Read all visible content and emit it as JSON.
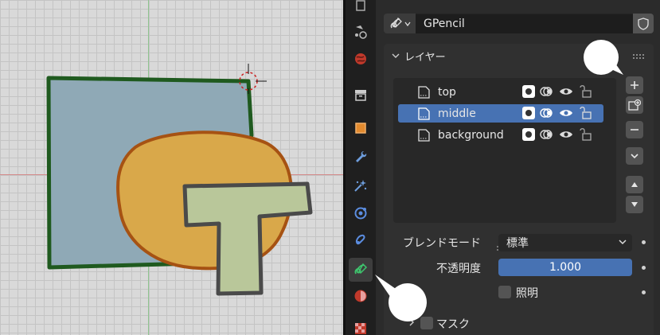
{
  "header": {
    "data_name": "GPencil"
  },
  "layers_panel": {
    "title": "レイヤー",
    "layers": [
      {
        "name": "top",
        "active": false
      },
      {
        "name": "middle",
        "active": true
      },
      {
        "name": "background",
        "active": false
      }
    ]
  },
  "properties": {
    "blend_mode_label": "ブレンドモード",
    "blend_mode_value": "標準",
    "opacity_label": "不透明度",
    "opacity_value": "1.000",
    "lights_label": "照明",
    "mask_label": "マスク"
  },
  "icons": {
    "tabs": [
      "tool-icon",
      "scene-icon",
      "world-icon",
      "collection-icon",
      "object-icon",
      "modifier-icon",
      "shader-fx-icon",
      "physics-icon",
      "constraint-icon",
      "gpencil-data-icon",
      "material-icon",
      "texture-icon"
    ],
    "side_buttons": [
      "add-layer-icon",
      "add-layer-group-icon",
      "remove-layer-icon",
      "menu-chevron-icon",
      "move-up-icon",
      "move-down-icon"
    ]
  },
  "colors": {
    "accent": "#4772b3",
    "active_tab_icon": "#3ec46d",
    "canvas_square_fill": "#8fa9b6",
    "canvas_square_stroke": "#1f5a1f",
    "canvas_blob_fill": "#d9a84a",
    "canvas_blob_stroke": "#a65213",
    "canvas_t_fill": "#b9c79a",
    "canvas_t_stroke": "#4a4a4a"
  }
}
